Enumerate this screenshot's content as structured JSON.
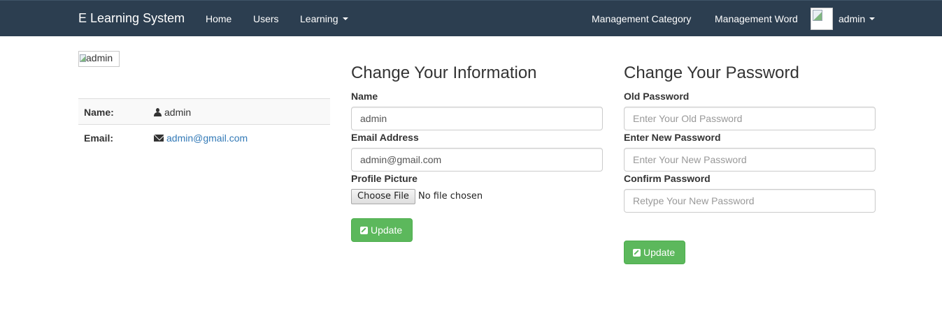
{
  "navbar": {
    "brand": "E Learning System",
    "links": {
      "home": "Home",
      "users": "Users",
      "learning": "Learning"
    },
    "right_links": {
      "category": "Management Category",
      "word": "Management Word"
    },
    "user": "admin"
  },
  "profile": {
    "image_alt": "admin",
    "name_label": "Name:",
    "name_value": "admin",
    "email_label": "Email:",
    "email_value": "admin@gmail.com"
  },
  "info_form": {
    "title": "Change Your Information",
    "name_label": "Name",
    "name_value": "admin",
    "email_label": "Email Address",
    "email_value": "admin@gmail.com",
    "picture_label": "Profile Picture",
    "file_button": "Choose File",
    "file_status": "No file chosen",
    "update_label": "Update"
  },
  "password_form": {
    "title": "Change Your Password",
    "old_label": "Old Password",
    "old_placeholder": "Enter Your Old Password",
    "new_label": "Enter New Password",
    "new_placeholder": "Enter Your New Password",
    "confirm_label": "Confirm Password",
    "confirm_placeholder": "Retype Your New Password",
    "update_label": "Update"
  },
  "colors": {
    "navbar_bg": "#2c3e50",
    "success": "#5cb85c",
    "link": "#337ab7"
  },
  "icons": [
    "user-icon",
    "envelope-icon",
    "edit-icon",
    "caret-down-icon",
    "broken-image-icon"
  ]
}
